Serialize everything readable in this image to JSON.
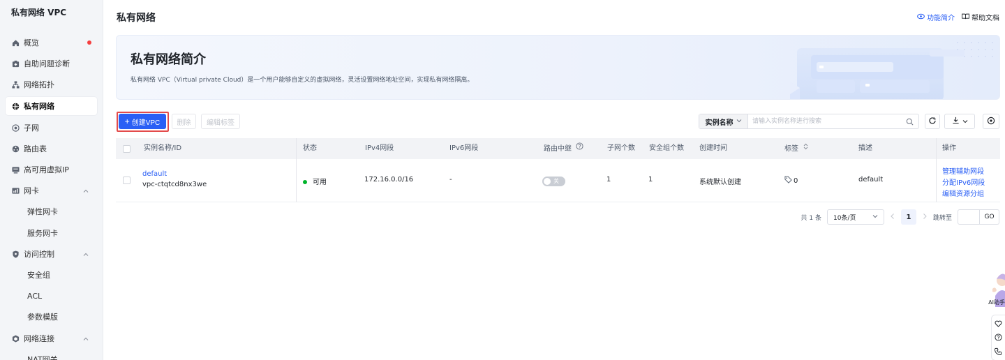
{
  "sidebar": {
    "title": "私有网络 VPC",
    "items": [
      {
        "label": "概览",
        "icon": "home-icon"
      },
      {
        "label": "自助问题诊断",
        "icon": "diagnose-icon"
      },
      {
        "label": "网络拓扑",
        "icon": "topology-icon"
      },
      {
        "label": "私有网络",
        "icon": "globe-icon"
      },
      {
        "label": "子网",
        "icon": "subnet-icon"
      },
      {
        "label": "路由表",
        "icon": "route-icon"
      },
      {
        "label": "高可用虚拟IP",
        "icon": "virtual-ip-icon"
      },
      {
        "label": "网卡",
        "icon": "nic-icon"
      },
      {
        "label": "弹性网卡"
      },
      {
        "label": "服务网卡"
      },
      {
        "label": "访问控制",
        "icon": "shield-icon"
      },
      {
        "label": "安全组"
      },
      {
        "label": "ACL"
      },
      {
        "label": "参数模版"
      },
      {
        "label": "网络连接",
        "icon": "connection-icon"
      },
      {
        "label": "NAT网关"
      }
    ]
  },
  "header": {
    "title": "私有网络",
    "feature_intro": "功能简介",
    "help_docs": "帮助文档"
  },
  "banner": {
    "title": "私有网络简介",
    "description": "私有网络 VPC（Virtual private Cloud）是一个用户能够自定义的虚拟网络，灵活设置网络地址空间，实现私有网络隔离。"
  },
  "toolbar": {
    "create_label": "创建VPC",
    "delete_label": "删除",
    "edit_tags_label": "编辑标签",
    "search_field": "实例名称",
    "search_placeholder": "请输入实例名称进行搜索"
  },
  "table": {
    "headers": {
      "name": "实例名称/ID",
      "status": "状态",
      "ipv4": "IPv4网段",
      "ipv6": "IPv6网段",
      "route_relay": "路由中继",
      "subnet_count": "子网个数",
      "sg_count": "安全组个数",
      "created": "创建时间",
      "tags": "标签",
      "description": "描述",
      "actions": "操作"
    },
    "rows": [
      {
        "name": "default",
        "id": "vpc-ctqtcd8nx3we",
        "status": "可用",
        "ipv4": "172.16.0.0/16",
        "ipv6": "-",
        "route_relay_toggle": "关",
        "subnet_count": "1",
        "sg_count": "1",
        "created": "系统默认创建",
        "tags": "0",
        "description": "default",
        "actions": [
          "管理辅助网段",
          "分配IPv6网段",
          "编辑资源分组"
        ]
      }
    ]
  },
  "pagination": {
    "total": "共 1 条",
    "page_size": "10条/页",
    "current_page": "1",
    "jump_label": "跳转至",
    "go_label": "GO"
  },
  "assistant": {
    "label": "AI助手"
  },
  "colors": {
    "primary": "#2a5ff5",
    "success": "#00b42a",
    "danger_dot": "#f53f3f",
    "highlight_border": "#e34b4b"
  }
}
